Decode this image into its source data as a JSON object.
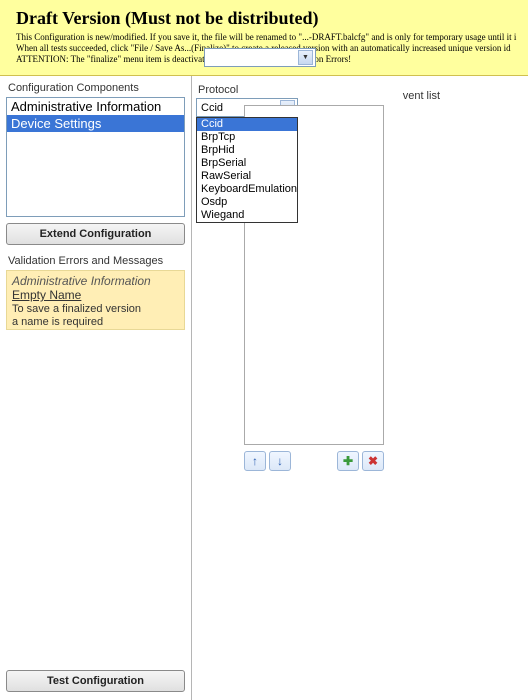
{
  "banner": {
    "title": "Draft Version (Must not be distributed)",
    "line1": "This Configuration is new/modified. If you save it, the file will be renamed to \"...-DRAFT.balcfg\" and is only for temporary usage until it i",
    "line2": "When all tests succeeded, click \"File / Save As...(Finalize)\" to create a released version with an automatically increased unique version id",
    "line3": "ATTENTION: The \"finalize\" menu item is deactivated as long as there are Validation Errors!"
  },
  "left": {
    "components_label": "Configuration Components",
    "items": [
      {
        "label": "Administrative Information",
        "selected": false
      },
      {
        "label": "Device Settings",
        "selected": true
      }
    ],
    "extend_btn": "Extend Configuration",
    "validation_label": "Validation Errors and Messages",
    "msg": {
      "head": "Administrative Information",
      "title": "Empty Name",
      "body1": "To save a finalized version",
      "body2": "a name is required"
    },
    "test_btn": "Test Configuration"
  },
  "right": {
    "protocol_label": "Protocol",
    "protocol_value": "Ccid",
    "protocol_options": [
      {
        "label": "Ccid",
        "selected": true
      },
      {
        "label": "BrpTcp",
        "selected": false
      },
      {
        "label": "BrpHid",
        "selected": false
      },
      {
        "label": "BrpSerial",
        "selected": false
      },
      {
        "label": "RawSerial",
        "selected": false
      },
      {
        "label": "KeyboardEmulation",
        "selected": false
      },
      {
        "label": "Osdp",
        "selected": false
      },
      {
        "label": "Wiegand",
        "selected": false
      }
    ],
    "events_caption": "vent list"
  }
}
